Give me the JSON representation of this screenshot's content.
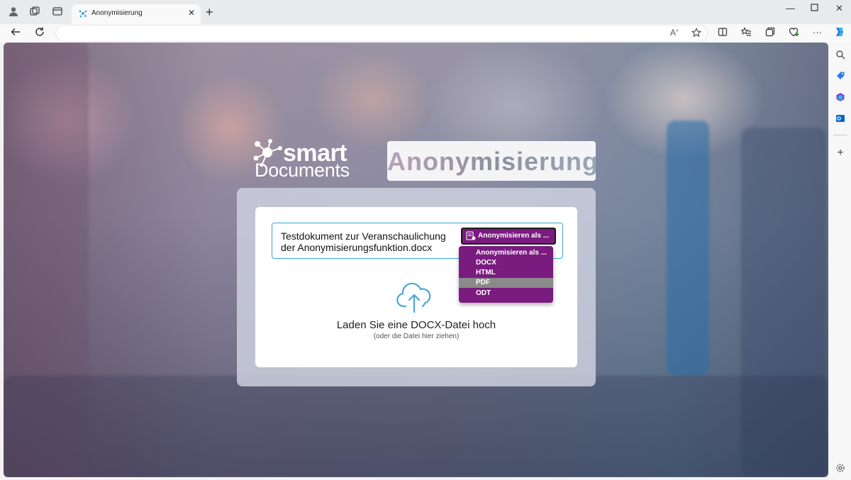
{
  "browser": {
    "tab_title": "Anonymisierung",
    "address_url": "",
    "window_controls": [
      "minimize-icon",
      "maximize-icon",
      "close-icon"
    ],
    "toolbar_icons": [
      "read-aloud-icon",
      "favorite-star-icon",
      "split-screen-icon",
      "favorites-icon",
      "collections-icon",
      "browser-essentials-icon",
      "more-icon",
      "copilot-icon"
    ],
    "sidebar_icons": [
      "search-icon",
      "shopping-tag-icon",
      "office-icon",
      "outlook-icon",
      "add-icon",
      "settings-icon"
    ]
  },
  "page": {
    "logo": {
      "line1": "smart",
      "line2": "Documents"
    },
    "title": "Anonymisierung",
    "file": {
      "name": "Testdokument zur Veranschaulichung der Anonymisierungsfunktion.docx"
    },
    "anonymize_button": {
      "label": "Anonymisieren als ..."
    },
    "dropdown": {
      "options": [
        "Anonymisieren als ...",
        "DOCX",
        "HTML",
        "PDF",
        "ODT"
      ],
      "highlighted": "PDF"
    },
    "upload": {
      "main_text": "Laden Sie eine DOCX-Datei hoch",
      "sub_text": "(oder die Datei hier ziehen)"
    },
    "colors": {
      "accent_purple": "#7a1b7f",
      "file_border": "#3aa6d4",
      "upload_icon": "#4aa8d8"
    }
  }
}
